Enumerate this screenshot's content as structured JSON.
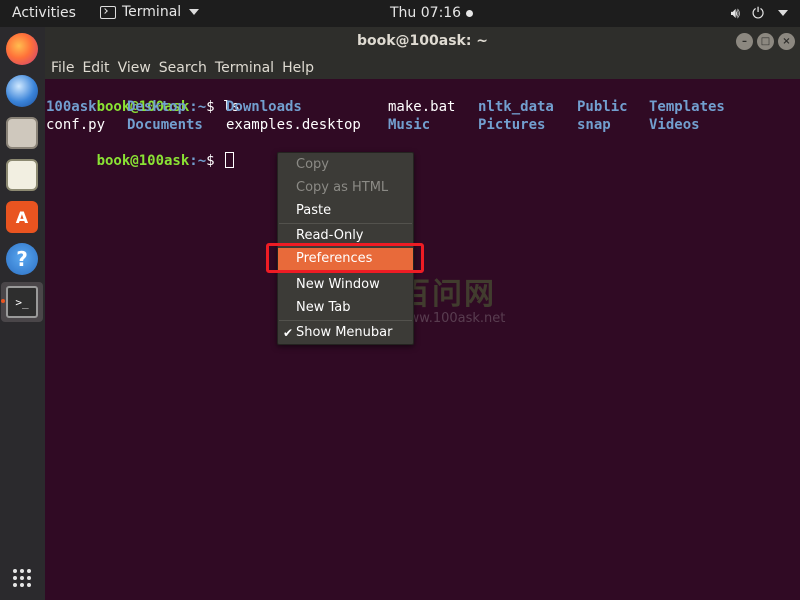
{
  "topbar": {
    "activities": "Activities",
    "app_name": "Terminal",
    "clock": "Thu 07:16",
    "tray": {
      "volume_icon": "volume-icon",
      "power_icon": "power-icon"
    }
  },
  "dock": {
    "items": [
      {
        "name": "firefox",
        "icon": "firefox-icon"
      },
      {
        "name": "thunderbird",
        "icon": "thunderbird-icon"
      },
      {
        "name": "files",
        "icon": "files-icon"
      },
      {
        "name": "rhythmbox",
        "icon": "rhythmbox-icon"
      },
      {
        "name": "software",
        "icon": "software-icon",
        "glyph": "A"
      },
      {
        "name": "help",
        "icon": "help-icon",
        "glyph": "?"
      },
      {
        "name": "terminal",
        "icon": "terminal-icon",
        "glyph": ">_"
      }
    ],
    "show_apps_icon": "grid-icon"
  },
  "window": {
    "title": "book@100ask: ~",
    "controls": {
      "minimize": "–",
      "maximize": "□",
      "close": "×"
    },
    "menu": [
      "File",
      "Edit",
      "View",
      "Search",
      "Terminal",
      "Help"
    ]
  },
  "terminal": {
    "prompt_user": "book@100ask",
    "prompt_path": ":~",
    "prompt_symbol": "$ ",
    "command": "ls",
    "listing": [
      {
        "name": "100ask",
        "type": "dir"
      },
      {
        "name": "Desktop",
        "type": "dir"
      },
      {
        "name": "Downloads",
        "type": "dir"
      },
      {
        "name": "make.bat",
        "type": "file"
      },
      {
        "name": "nltk_data",
        "type": "dir"
      },
      {
        "name": "Public",
        "type": "dir"
      },
      {
        "name": "Templates",
        "type": "dir"
      },
      {
        "name": "conf.py",
        "type": "file"
      },
      {
        "name": "Documents",
        "type": "dir"
      },
      {
        "name": "examples.desktop",
        "type": "file"
      },
      {
        "name": "Music",
        "type": "dir"
      },
      {
        "name": "Pictures",
        "type": "dir"
      },
      {
        "name": "snap",
        "type": "dir"
      },
      {
        "name": "Videos",
        "type": "dir"
      }
    ]
  },
  "watermark": {
    "title": "百问网",
    "url": "www.100ask.net"
  },
  "context_menu": {
    "items": [
      {
        "label": "Copy",
        "enabled": false
      },
      {
        "label": "Copy as HTML",
        "enabled": false
      },
      {
        "label": "Paste",
        "enabled": true
      },
      {
        "label": "Read-Only",
        "enabled": true
      },
      {
        "label": "Preferences",
        "enabled": true,
        "highlighted": true
      },
      {
        "label": "New Window",
        "enabled": true
      },
      {
        "label": "New Tab",
        "enabled": true
      },
      {
        "label": "Show Menubar",
        "enabled": true,
        "checked": true
      }
    ],
    "check_glyph": "✔"
  },
  "colors": {
    "terminal_bg": "#300a24",
    "prompt_user": "#8ae234",
    "directory": "#729fcf",
    "menu_highlight": "#e86a3a",
    "annotation_box": "#ee1c24"
  }
}
